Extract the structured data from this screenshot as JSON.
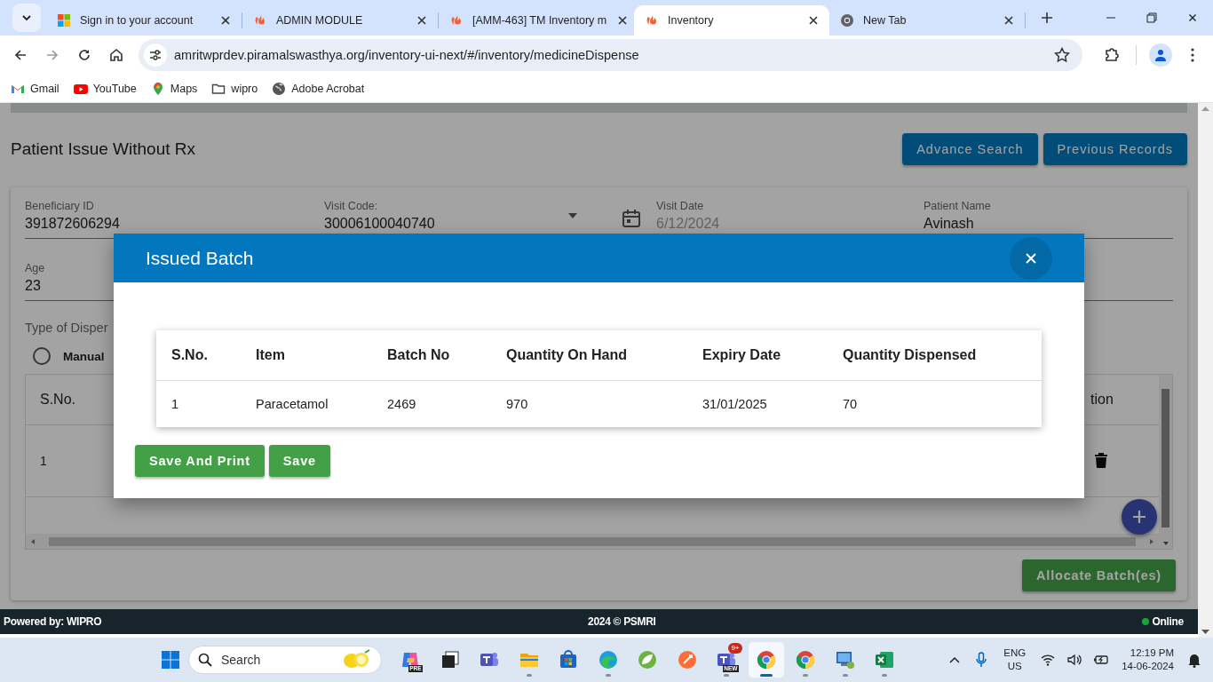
{
  "browser": {
    "tabs": [
      {
        "title": "Sign in to your account",
        "kind": "squares",
        "selected": false
      },
      {
        "title": "ADMIN MODULE",
        "kind": "flame",
        "selected": false
      },
      {
        "title": "[AMM-463] TM Inventory m",
        "kind": "flame",
        "selected": false
      },
      {
        "title": "Inventory",
        "kind": "flame",
        "selected": true
      },
      {
        "title": "New Tab",
        "kind": "ring",
        "selected": false
      }
    ],
    "url": "amritwprdev.piramalswasthya.org/inventory-ui-next/#/inventory/medicineDispense",
    "bookmarks": [
      {
        "label": "Gmail",
        "kind": "mail"
      },
      {
        "label": "YouTube",
        "kind": "play"
      },
      {
        "label": "Maps",
        "kind": "pin"
      },
      {
        "label": "wipro",
        "kind": "folder"
      },
      {
        "label": "Adobe Acrobat",
        "kind": "globe"
      }
    ]
  },
  "page": {
    "title": "Patient Issue Without Rx",
    "buttons": [
      "Advance Search",
      "Previous Records"
    ],
    "fields": [
      {
        "label": "Beneficiary ID",
        "value": "391872606294",
        "kind": "text",
        "disabled": false
      },
      {
        "label": "Visit Code:",
        "value": "30006100040740",
        "kind": "select",
        "disabled": false
      },
      {
        "label": "Visit Date",
        "value": "6/12/2024",
        "kind": "date",
        "disabled": true
      },
      {
        "label": "Patient Name",
        "value": "Avinash",
        "kind": "text",
        "disabled": false
      },
      {
        "label": "Age",
        "value": "23",
        "kind": "text",
        "disabled": false
      }
    ],
    "dispense_type": {
      "label": "Type of Disper",
      "options": [
        {
          "label": "Manual",
          "selected": false
        }
      ]
    },
    "table": {
      "columns": [
        "S.No.",
        "tion"
      ],
      "rows": [
        {
          "cells": [
            "1"
          ]
        }
      ]
    },
    "allocate_button": "Allocate Batch(es)"
  },
  "modal": {
    "title": "Issued Batch",
    "columns": [
      "S.No.",
      "Item",
      "Batch No",
      "Quantity On Hand",
      "Expiry Date",
      "Quantity Dispensed"
    ],
    "rows": [
      [
        "1",
        "Paracetamol",
        "2469",
        "970",
        "31/01/2025",
        "70"
      ]
    ],
    "buttons": [
      "Save And Print",
      "Save"
    ]
  },
  "footer": {
    "left": "Powered by: WIPRO",
    "center": "2024 © PSMRI",
    "status": "Online"
  },
  "taskbar": {
    "search_placeholder": "Search",
    "apps": [
      {
        "kind": "swirl",
        "tag": "PRE",
        "running": false,
        "selected": false
      },
      {
        "kind": "windows",
        "running": false,
        "selected": false
      },
      {
        "kind": "team",
        "running": false,
        "selected": false
      },
      {
        "kind": "folder",
        "running": true,
        "selected": false
      },
      {
        "kind": "bag",
        "running": false,
        "selected": false
      },
      {
        "kind": "wave",
        "running": true,
        "selected": false
      },
      {
        "kind": "leaf",
        "running": false,
        "selected": false
      },
      {
        "kind": "rocket",
        "running": false,
        "selected": false
      },
      {
        "kind": "team",
        "tag": "NEW",
        "badge": "9+",
        "running": true,
        "selected": false
      },
      {
        "kind": "ring",
        "running": true,
        "selected": true
      },
      {
        "kind": "ring",
        "running": true,
        "selected": false
      },
      {
        "kind": "monitor",
        "running": true,
        "selected": false
      },
      {
        "kind": "sheet",
        "running": true,
        "selected": false
      }
    ],
    "language": "ENG",
    "region": "US",
    "time": "12:19 PM",
    "date": "14-06-2024"
  }
}
